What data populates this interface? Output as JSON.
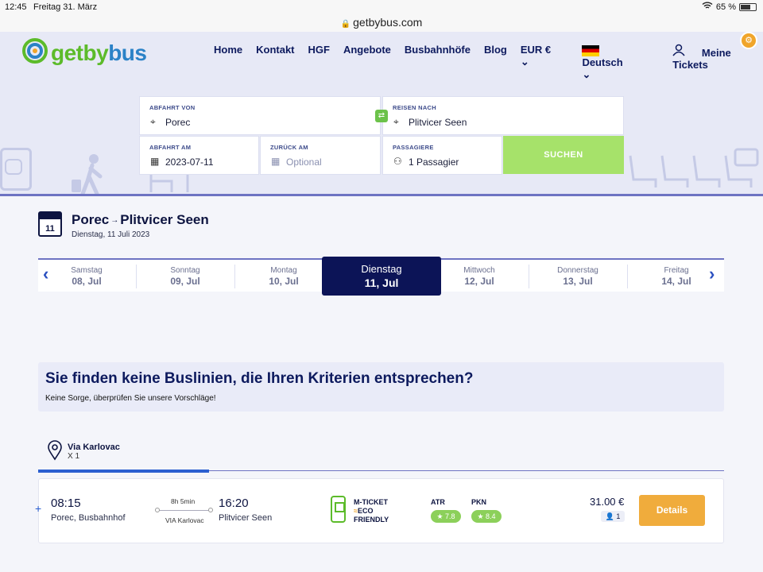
{
  "statusbar": {
    "time": "12:45",
    "date": "Freitag 31. März",
    "battery": "65 %"
  },
  "browser": {
    "url": "getbybus.com"
  },
  "brand": {
    "get": "get",
    "by": "by",
    "bus": "bus"
  },
  "nav": {
    "items": [
      "Home",
      "Kontakt",
      "HGF",
      "Angebote",
      "Busbahnhöfe",
      "Blog"
    ],
    "currency": "EUR €",
    "language": "Deutsch",
    "tickets": "Meine Tickets"
  },
  "search": {
    "from_label": "ABFAHRT VON",
    "from_value": "Porec",
    "to_label": "REISEN NACH",
    "to_value": "Plitvicer Seen",
    "depart_label": "ABFAHRT AM",
    "depart_value": "2023-07-11",
    "return_label": "ZURÜCK AM",
    "return_placeholder": "Optional",
    "pax_label": "PASSAGIERE",
    "pax_value": "1 Passagier",
    "search_button": "SUCHEN"
  },
  "route": {
    "cal_day": "11",
    "from": "Porec",
    "to": "Plitvicer Seen",
    "date_full": "Dienstag, 11 Juli 2023"
  },
  "dates": [
    {
      "day": "Samstag",
      "date": "08, Jul"
    },
    {
      "day": "Sonntag",
      "date": "09, Jul"
    },
    {
      "day": "Montag",
      "date": "10, Jul"
    },
    {
      "day": "Dienstag",
      "date": "11, Jul"
    },
    {
      "day": "Mittwoch",
      "date": "12, Jul"
    },
    {
      "day": "Donnerstag",
      "date": "13, Jul"
    },
    {
      "day": "Freitag",
      "date": "14, Jul"
    }
  ],
  "notice": {
    "title": "Sie finden keine Buslinien, die Ihren Kriterien entsprechen?",
    "text": "Keine Sorge, überprüfen Sie unsere Vorschläge!"
  },
  "via_tab": {
    "title": "Via Karlovac",
    "sub": "X 1"
  },
  "trip": {
    "dep_time": "08:15",
    "dep_place": "Porec, Busbahnhof",
    "duration": "8h 5min",
    "via": "VIA Karlovac",
    "arr_time": "16:20",
    "arr_place": "Plitvicer Seen",
    "features": [
      "M-TICKET",
      "ECO",
      "FRIENDLY"
    ],
    "ratings": [
      {
        "label": "ATR",
        "score": "7.8"
      },
      {
        "label": "PKN",
        "score": "8.4"
      }
    ],
    "price": "31.00 €",
    "pax": "1",
    "details_button": "Details"
  },
  "colors": {
    "brand_green": "#5cbb2a",
    "brand_blue": "#2b82c7",
    "navy": "#0c1457",
    "accent_orange": "#f0ac3c",
    "search_green": "#a6e26a"
  }
}
